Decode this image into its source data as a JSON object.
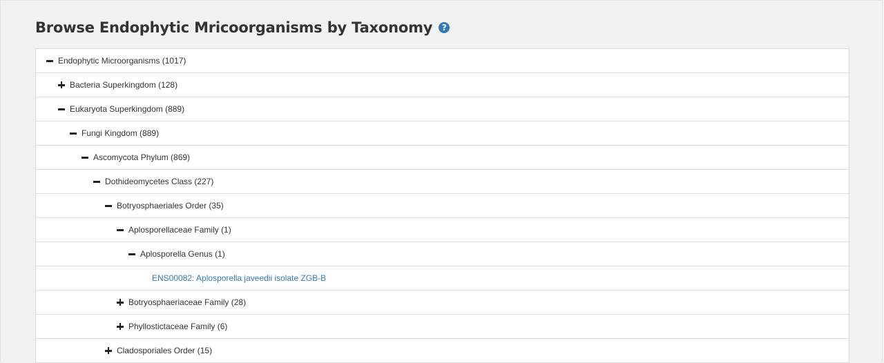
{
  "page": {
    "title": "Browse Endophytic Mricoorganisms by Taxonomy",
    "help_icon": "question-circle-icon",
    "help_color": "#337ab7"
  },
  "tree": {
    "link_color": "#337ab7",
    "nodes": [
      {
        "label": "Endophytic Microorganisms (1017)",
        "depth": 0,
        "state": "expanded"
      },
      {
        "label": "Bacteria Superkingdom (128)",
        "depth": 1,
        "state": "collapsed"
      },
      {
        "label": "Eukaryota Superkingdom (889)",
        "depth": 1,
        "state": "expanded"
      },
      {
        "label": "Fungi Kingdom (889)",
        "depth": 2,
        "state": "expanded"
      },
      {
        "label": "Ascomycota Phylum (869)",
        "depth": 3,
        "state": "expanded"
      },
      {
        "label": "Dothideomycetes Class (227)",
        "depth": 4,
        "state": "expanded"
      },
      {
        "label": "Botryosphaeriales Order (35)",
        "depth": 5,
        "state": "expanded"
      },
      {
        "label": "Aplosporellaceae Family (1)",
        "depth": 6,
        "state": "expanded"
      },
      {
        "label": "Aplosporella Genus (1)",
        "depth": 7,
        "state": "expanded"
      },
      {
        "label": "ENS00082: Aplosporella javeedii isolate ZGB-B",
        "depth": 9,
        "state": "leaf"
      },
      {
        "label": "Botryosphaeriaceae Family (28)",
        "depth": 6,
        "state": "collapsed"
      },
      {
        "label": "Phyllostictaceae Family (6)",
        "depth": 6,
        "state": "collapsed"
      },
      {
        "label": "Cladosporiales Order (15)",
        "depth": 5,
        "state": "collapsed"
      }
    ]
  }
}
